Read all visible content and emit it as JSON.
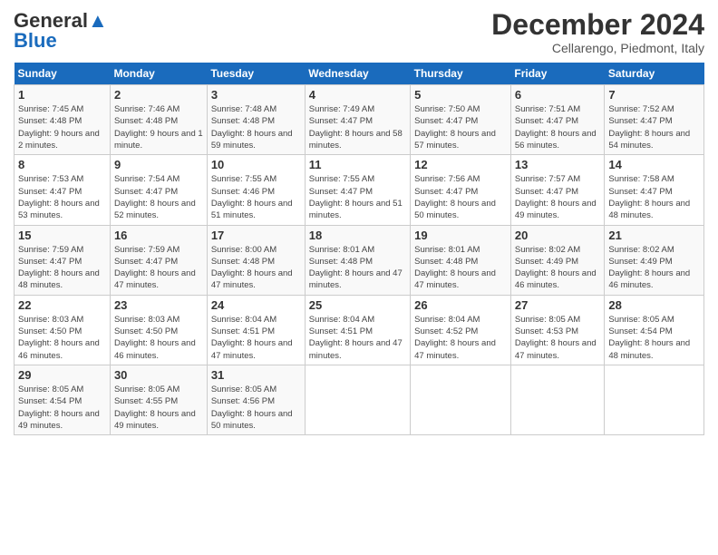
{
  "header": {
    "logo_general": "General",
    "logo_blue": "Blue",
    "month_title": "December 2024",
    "location": "Cellarengo, Piedmont, Italy"
  },
  "days_of_week": [
    "Sunday",
    "Monday",
    "Tuesday",
    "Wednesday",
    "Thursday",
    "Friday",
    "Saturday"
  ],
  "weeks": [
    {
      "days": [
        {
          "num": "1",
          "sunrise": "7:45 AM",
          "sunset": "4:48 PM",
          "daylight": "9 hours and 2 minutes."
        },
        {
          "num": "2",
          "sunrise": "7:46 AM",
          "sunset": "4:48 PM",
          "daylight": "9 hours and 1 minute."
        },
        {
          "num": "3",
          "sunrise": "7:48 AM",
          "sunset": "4:48 PM",
          "daylight": "8 hours and 59 minutes."
        },
        {
          "num": "4",
          "sunrise": "7:49 AM",
          "sunset": "4:47 PM",
          "daylight": "8 hours and 58 minutes."
        },
        {
          "num": "5",
          "sunrise": "7:50 AM",
          "sunset": "4:47 PM",
          "daylight": "8 hours and 57 minutes."
        },
        {
          "num": "6",
          "sunrise": "7:51 AM",
          "sunset": "4:47 PM",
          "daylight": "8 hours and 56 minutes."
        },
        {
          "num": "7",
          "sunrise": "7:52 AM",
          "sunset": "4:47 PM",
          "daylight": "8 hours and 54 minutes."
        }
      ]
    },
    {
      "days": [
        {
          "num": "8",
          "sunrise": "7:53 AM",
          "sunset": "4:47 PM",
          "daylight": "8 hours and 53 minutes."
        },
        {
          "num": "9",
          "sunrise": "7:54 AM",
          "sunset": "4:47 PM",
          "daylight": "8 hours and 52 minutes."
        },
        {
          "num": "10",
          "sunrise": "7:55 AM",
          "sunset": "4:46 PM",
          "daylight": "8 hours and 51 minutes."
        },
        {
          "num": "11",
          "sunrise": "7:55 AM",
          "sunset": "4:47 PM",
          "daylight": "8 hours and 51 minutes."
        },
        {
          "num": "12",
          "sunrise": "7:56 AM",
          "sunset": "4:47 PM",
          "daylight": "8 hours and 50 minutes."
        },
        {
          "num": "13",
          "sunrise": "7:57 AM",
          "sunset": "4:47 PM",
          "daylight": "8 hours and 49 minutes."
        },
        {
          "num": "14",
          "sunrise": "7:58 AM",
          "sunset": "4:47 PM",
          "daylight": "8 hours and 48 minutes."
        }
      ]
    },
    {
      "days": [
        {
          "num": "15",
          "sunrise": "7:59 AM",
          "sunset": "4:47 PM",
          "daylight": "8 hours and 48 minutes."
        },
        {
          "num": "16",
          "sunrise": "7:59 AM",
          "sunset": "4:47 PM",
          "daylight": "8 hours and 47 minutes."
        },
        {
          "num": "17",
          "sunrise": "8:00 AM",
          "sunset": "4:48 PM",
          "daylight": "8 hours and 47 minutes."
        },
        {
          "num": "18",
          "sunrise": "8:01 AM",
          "sunset": "4:48 PM",
          "daylight": "8 hours and 47 minutes."
        },
        {
          "num": "19",
          "sunrise": "8:01 AM",
          "sunset": "4:48 PM",
          "daylight": "8 hours and 47 minutes."
        },
        {
          "num": "20",
          "sunrise": "8:02 AM",
          "sunset": "4:49 PM",
          "daylight": "8 hours and 46 minutes."
        },
        {
          "num": "21",
          "sunrise": "8:02 AM",
          "sunset": "4:49 PM",
          "daylight": "8 hours and 46 minutes."
        }
      ]
    },
    {
      "days": [
        {
          "num": "22",
          "sunrise": "8:03 AM",
          "sunset": "4:50 PM",
          "daylight": "8 hours and 46 minutes."
        },
        {
          "num": "23",
          "sunrise": "8:03 AM",
          "sunset": "4:50 PM",
          "daylight": "8 hours and 46 minutes."
        },
        {
          "num": "24",
          "sunrise": "8:04 AM",
          "sunset": "4:51 PM",
          "daylight": "8 hours and 47 minutes."
        },
        {
          "num": "25",
          "sunrise": "8:04 AM",
          "sunset": "4:51 PM",
          "daylight": "8 hours and 47 minutes."
        },
        {
          "num": "26",
          "sunrise": "8:04 AM",
          "sunset": "4:52 PM",
          "daylight": "8 hours and 47 minutes."
        },
        {
          "num": "27",
          "sunrise": "8:05 AM",
          "sunset": "4:53 PM",
          "daylight": "8 hours and 47 minutes."
        },
        {
          "num": "28",
          "sunrise": "8:05 AM",
          "sunset": "4:54 PM",
          "daylight": "8 hours and 48 minutes."
        }
      ]
    },
    {
      "days": [
        {
          "num": "29",
          "sunrise": "8:05 AM",
          "sunset": "4:54 PM",
          "daylight": "8 hours and 49 minutes."
        },
        {
          "num": "30",
          "sunrise": "8:05 AM",
          "sunset": "4:55 PM",
          "daylight": "8 hours and 49 minutes."
        },
        {
          "num": "31",
          "sunrise": "8:05 AM",
          "sunset": "4:56 PM",
          "daylight": "8 hours and 50 minutes."
        },
        null,
        null,
        null,
        null
      ]
    }
  ],
  "labels": {
    "sunrise": "Sunrise:",
    "sunset": "Sunset:",
    "daylight": "Daylight:"
  }
}
